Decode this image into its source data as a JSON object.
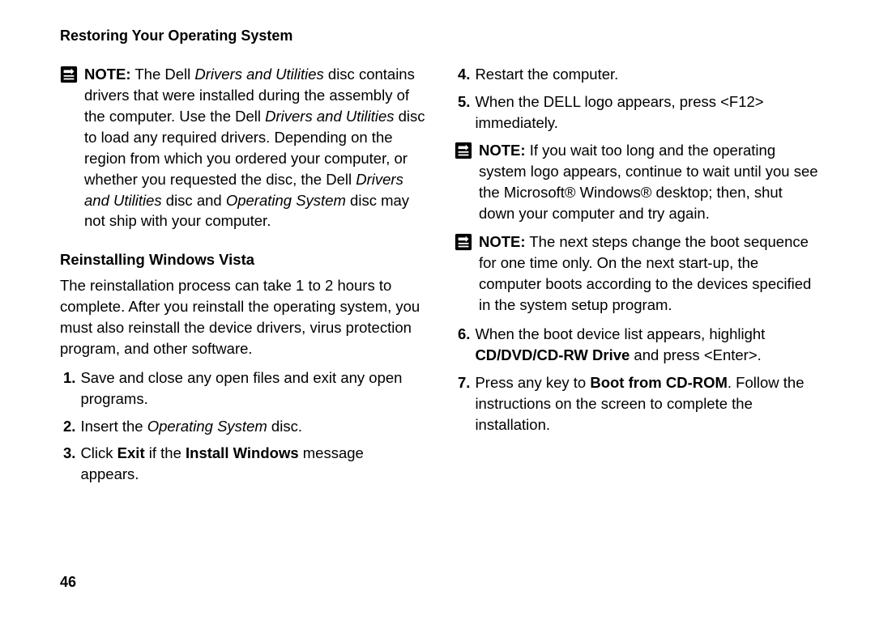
{
  "header": {
    "title": "Restoring Your Operating System"
  },
  "page_number": "46",
  "left": {
    "note1": {
      "label": "NOTE:",
      "t1": " The Dell ",
      "i1": "Drivers and Utilities",
      "t2": " disc contains drivers that were installed during the assembly of the computer. Use the Dell ",
      "i2": "Drivers and Utilities",
      "t3": " disc to load any required drivers. Depending on the region from which you ordered your computer, or whether you requested the disc, the Dell ",
      "i3": "Drivers and Utilities",
      "t4": " disc and ",
      "i4": "Operating System",
      "t5": " disc may not ship with your computer."
    },
    "h2": "Reinstalling Windows Vista",
    "para1": "The reinstallation process can take 1 to 2 hours to complete. After you reinstall the operating system, you must also reinstall the device drivers, virus protection program, and other software.",
    "s1": {
      "n": "1.",
      "t": "Save and close any open files and exit any open programs."
    },
    "s2": {
      "n": "2.",
      "t1": "Insert the ",
      "i1": "Operating System",
      "t2": " disc."
    },
    "s3": {
      "n": "3.",
      "t1": "Click ",
      "b1": "Exit",
      "t2": " if the ",
      "b2": "Install Windows",
      "t3": " message appears."
    }
  },
  "right": {
    "s4": {
      "n": "4.",
      "t": "Restart the computer."
    },
    "s5": {
      "n": "5.",
      "t": "When the DELL logo appears, press <F12> immediately."
    },
    "note2": {
      "label": "NOTE:",
      "t": " If you wait too long and the operating system logo appears, continue to wait until you see the Microsoft® Windows® desktop; then, shut down your computer and try again."
    },
    "note3": {
      "label": "NOTE:",
      "t": " The next steps change the boot sequence for one time only. On the next start-up, the computer boots according to the devices specified in the system setup program."
    },
    "s6": {
      "n": "6.",
      "t1": "When the boot device list appears, highlight ",
      "b1": "CD/DVD/CD-RW Drive",
      "t2": " and press <Enter>."
    },
    "s7": {
      "n": "7.",
      "t1": "Press any key to ",
      "b1": "Boot from CD-ROM",
      "t2": ". Follow the instructions on the screen to complete the installation."
    }
  }
}
